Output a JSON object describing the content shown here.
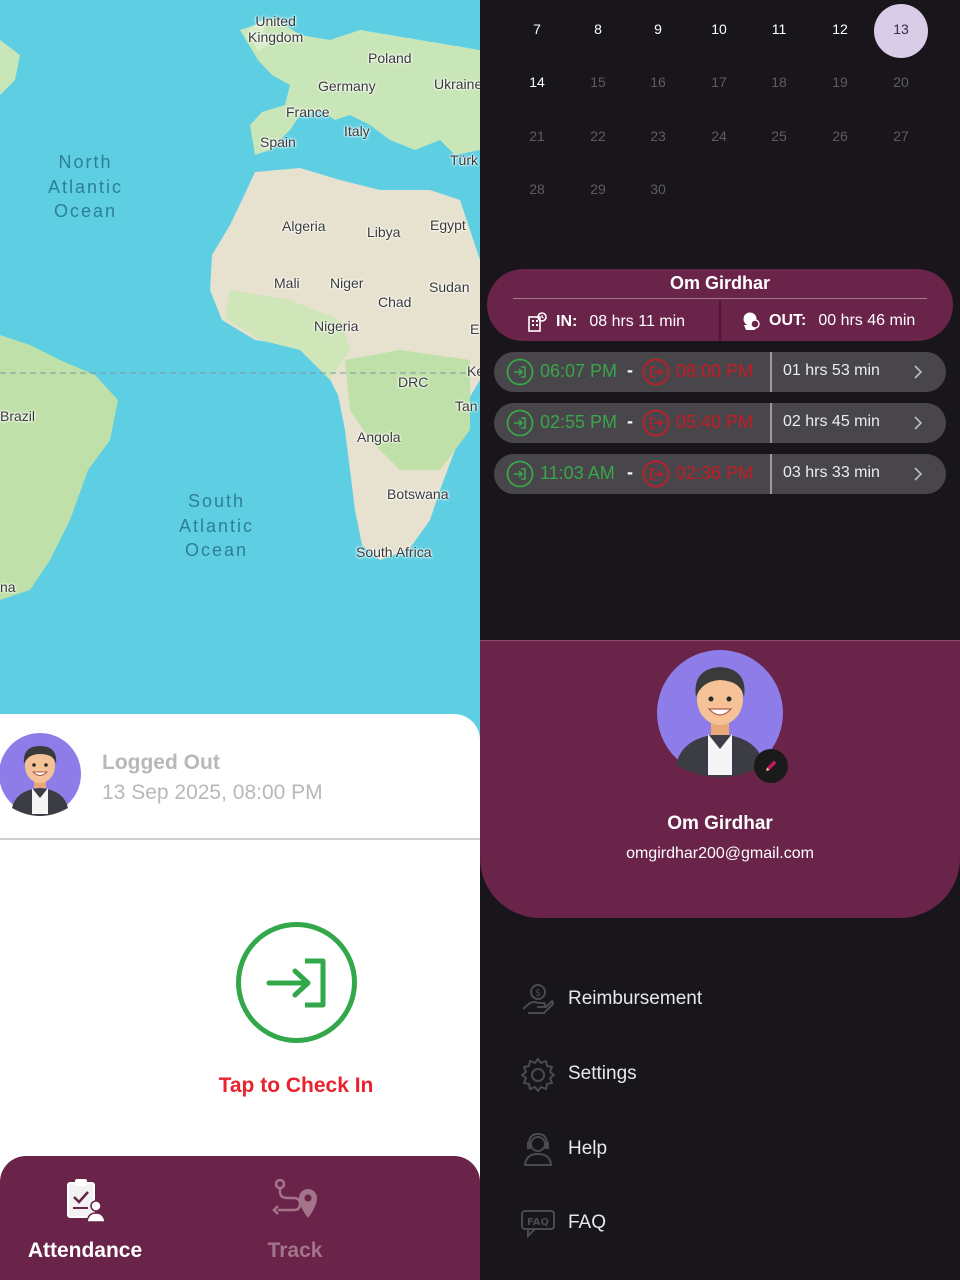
{
  "map": {
    "countries": {
      "uk": "United\nKingdom",
      "poland": "Poland",
      "germany": "Germany",
      "ukraine": "Ukraine",
      "france": "France",
      "italy": "Italy",
      "spain": "Spain",
      "turkey": "Türk",
      "algeria": "Algeria",
      "libya": "Libya",
      "egypt": "Egypt",
      "mali": "Mali",
      "niger": "Niger",
      "sudan": "Sudan",
      "chad": "Chad",
      "nigeria": "Nigeria",
      "e_edge": "E",
      "drc": "DRC",
      "ke": "Ke",
      "tan": "Tan",
      "brazil": "Brazil",
      "angola": "Angola",
      "botswana": "Botswana",
      "south_africa": "South Africa",
      "na": "na"
    },
    "oceans": {
      "north_atlantic": "North\nAtlantic\nOcean",
      "south_atlantic": "South\nAtlantic\nOcean"
    }
  },
  "status": {
    "title": "Logged Out",
    "time": "13 Sep 2025, 08:00 PM"
  },
  "checkin": {
    "label": "Tap to Check In",
    "icon": "check-in-arrow-icon"
  },
  "bottom_nav": {
    "items": [
      {
        "label": "Attendance",
        "icon": "clipboard-user-icon",
        "active": true
      },
      {
        "label": "Track",
        "icon": "route-pin-icon",
        "active": false
      }
    ]
  },
  "calendar": {
    "rows": [
      [
        "7",
        "8",
        "9",
        "10",
        "11",
        "12",
        "13"
      ],
      [
        "14",
        "15",
        "16",
        "17",
        "18",
        "19",
        "20"
      ],
      [
        "21",
        "22",
        "23",
        "24",
        "25",
        "26",
        "27"
      ],
      [
        "28",
        "29",
        "30"
      ]
    ],
    "selected": "13"
  },
  "summary": {
    "name": "Om Girdhar",
    "in_label": "IN:",
    "in_value": "08 hrs 11 min",
    "out_label": "OUT:",
    "out_value": "00 hrs 46 min"
  },
  "sessions": [
    {
      "in": "06:07 PM",
      "dash": "-",
      "out": "08:00 PM",
      "duration": "01 hrs 53 min"
    },
    {
      "in": "02:55 PM",
      "dash": "-",
      "out": "05:40 PM",
      "duration": "02 hrs 45 min"
    },
    {
      "in": "11:03 AM",
      "dash": "-",
      "out": "02:36 PM",
      "duration": "03 hrs 33 min"
    }
  ],
  "profile": {
    "name": "Om Girdhar",
    "email": "omgirdhar200@gmail.com"
  },
  "menu": [
    {
      "label": "Reimbursement",
      "icon": "money-hand-icon"
    },
    {
      "label": "Settings",
      "icon": "gear-icon"
    },
    {
      "label": "Help",
      "icon": "support-agent-icon"
    },
    {
      "label": "FAQ",
      "icon": "faq-icon"
    }
  ],
  "colors": {
    "brand": "#6a2349",
    "checkin_green": "#33a84a",
    "checkout_red": "#c41c24",
    "map_water": "#5ecfe2",
    "dark_bg": "#18161b"
  }
}
